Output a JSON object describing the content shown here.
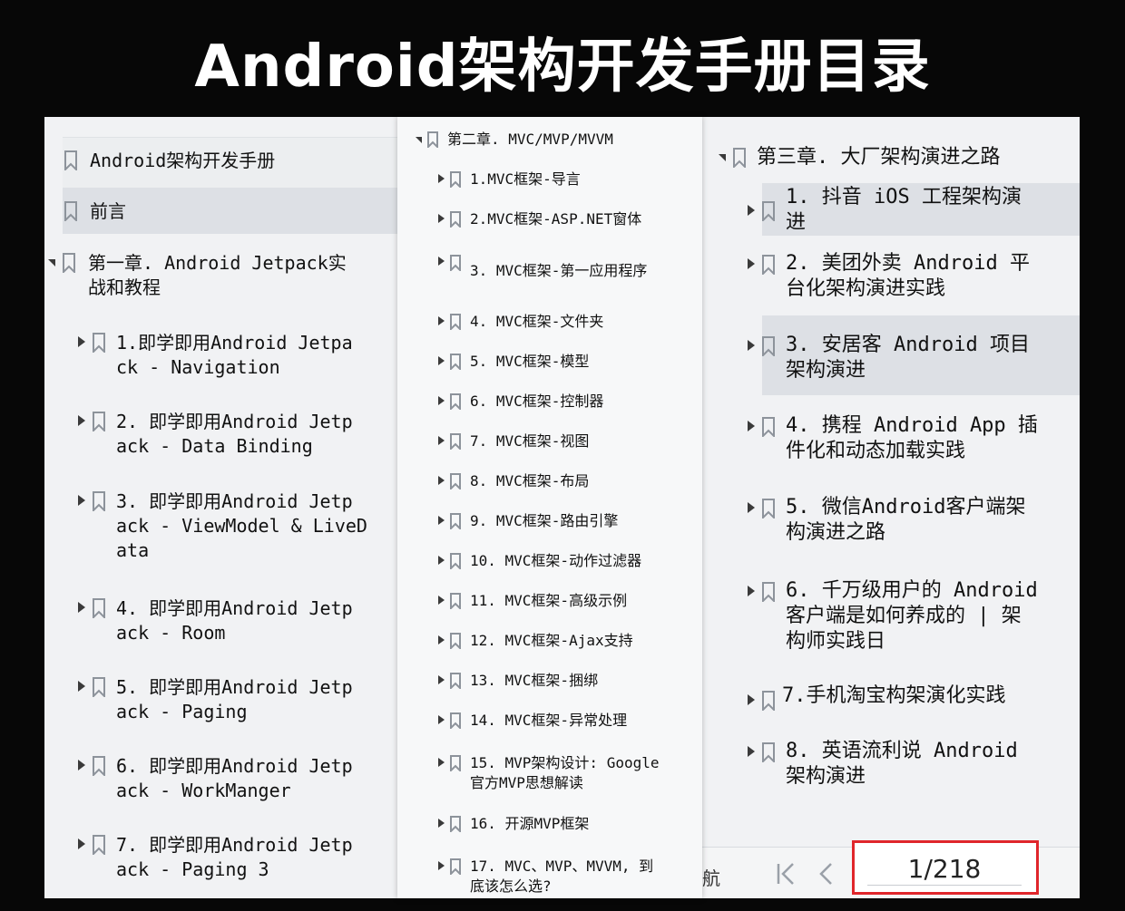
{
  "title": "Android架构开发手册目录",
  "panel1": {
    "root": "Android架构开发手册",
    "preface": "前言",
    "chapter": "第一章. Android Jetpack实\n战和教程",
    "items": [
      "1.即学即用Android Jetpa\nck - Navigation",
      "2. 即学即用Android Jetp\nack - Data Binding",
      "3. 即学即用Android Jetp\nack - ViewModel & LiveD\nata",
      "4. 即学即用Android Jetp\nack - Room",
      "5. 即学即用Android Jetp\nack - Paging",
      "6. 即学即用Android Jetp\nack - WorkManger",
      "7. 即学即用Android Jetp\nack - Paging 3"
    ]
  },
  "panel2": {
    "chapter": "第二章. MVC/MVP/MVVM",
    "items": [
      "1.MVC框架-导言",
      "2.MVC框架-ASP.NET窗体",
      "3. MVC框架-第一应用程序",
      "4. MVC框架-文件夹",
      "5. MVC框架-模型",
      "6. MVC框架-控制器",
      "7. MVC框架-视图",
      "8. MVC框架-布局",
      "9. MVC框架-路由引擎",
      "10. MVC框架-动作过滤器",
      "11. MVC框架-高级示例",
      "12. MVC框架-Ajax支持",
      "13. MVC框架-捆绑",
      "14. MVC框架-异常处理",
      "15. MVP架构设计: Google\n官方MVP思想解读",
      "16. 开源MVP框架",
      "17. MVC、MVP、MVVM, 到\n底该怎么选?"
    ]
  },
  "panel3": {
    "chapter": "第三章. 大厂架构演进之路",
    "items": [
      "1. 抖音 iOS 工程架构演\n进",
      "2. 美团外卖 Android 平\n台化架构演进实践",
      "3. 安居客 Android 项目\n架构演进",
      "4. 携程 Android App 插\n件化和动态加载实践",
      "5. 微信Android客户端架\n构演进之路",
      "6. 千万级用户的 Android\n客户端是如何养成的 | 架\n构师实践日",
      "7.手机淘宝构架演化实践",
      "8. 英语流利说 Android\n架构演进"
    ],
    "nav": {
      "label": "航",
      "first_icon": "first-page-icon",
      "prev_icon": "prev-page-icon",
      "page": "1/218"
    }
  },
  "colors": {
    "background": "#070707",
    "panel": "#f1f2f4",
    "highlight": "#dde0e5",
    "page_box_border": "#e0262b",
    "bookmark_icon": "#8d939b"
  }
}
